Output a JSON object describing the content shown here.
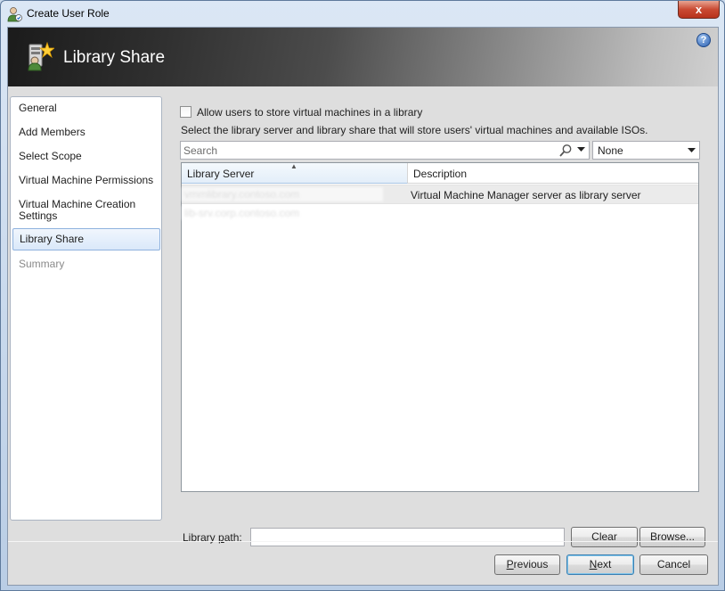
{
  "window": {
    "title": "Create User Role",
    "close_glyph": "x"
  },
  "banner": {
    "title": "Library Share",
    "help_glyph": "?"
  },
  "nav": {
    "items": [
      {
        "label": "General",
        "state": "normal"
      },
      {
        "label": "Add Members",
        "state": "normal"
      },
      {
        "label": "Select Scope",
        "state": "normal"
      },
      {
        "label": "Virtual Machine Permissions",
        "state": "normal"
      },
      {
        "label": "Virtual Machine Creation Settings",
        "state": "normal"
      },
      {
        "label": "Library Share",
        "state": "selected"
      },
      {
        "label": "Summary",
        "state": "disabled"
      }
    ]
  },
  "main": {
    "allow_checkbox": {
      "label": "Allow users to store virtual machines in a library",
      "checked": false
    },
    "instruction": "Select the library server and library share that will store users' virtual machines and available ISOs.",
    "search": {
      "placeholder": "Search"
    },
    "filter": {
      "value": "None"
    },
    "grid": {
      "columns": [
        "Library Server",
        "Description"
      ],
      "sorted_column": "Library Server",
      "rows": [
        {
          "server": "vmmlibrary.contoso.com",
          "description": "Virtual Machine Manager server as library server",
          "selected": true
        },
        {
          "server": "lib-srv.corp.contoso.com",
          "description": "",
          "selected": false
        }
      ]
    },
    "library_path": {
      "label_pre": "Library ",
      "label_key": "p",
      "label_post": "ath:",
      "value": ""
    },
    "clear_button": {
      "key": "C",
      "rest": "lear"
    },
    "browse_button": {
      "key": "B",
      "rest": "rowse..."
    }
  },
  "footer": {
    "previous_button": {
      "key": "P",
      "rest": "revious"
    },
    "next_button": {
      "key": "N",
      "rest": "ext"
    },
    "cancel_button": "Cancel"
  },
  "icons": {
    "title": "user-role-icon",
    "banner": "library-share-icon",
    "help": "help-icon",
    "search": "magnifier-icon",
    "dropdown": "chevron-down-icon"
  },
  "colors": {
    "selection_border": "#8fb2de",
    "selection_fill": "#dae8fa",
    "banner_dark": "#1b1b1b",
    "close_red": "#c94a33"
  }
}
